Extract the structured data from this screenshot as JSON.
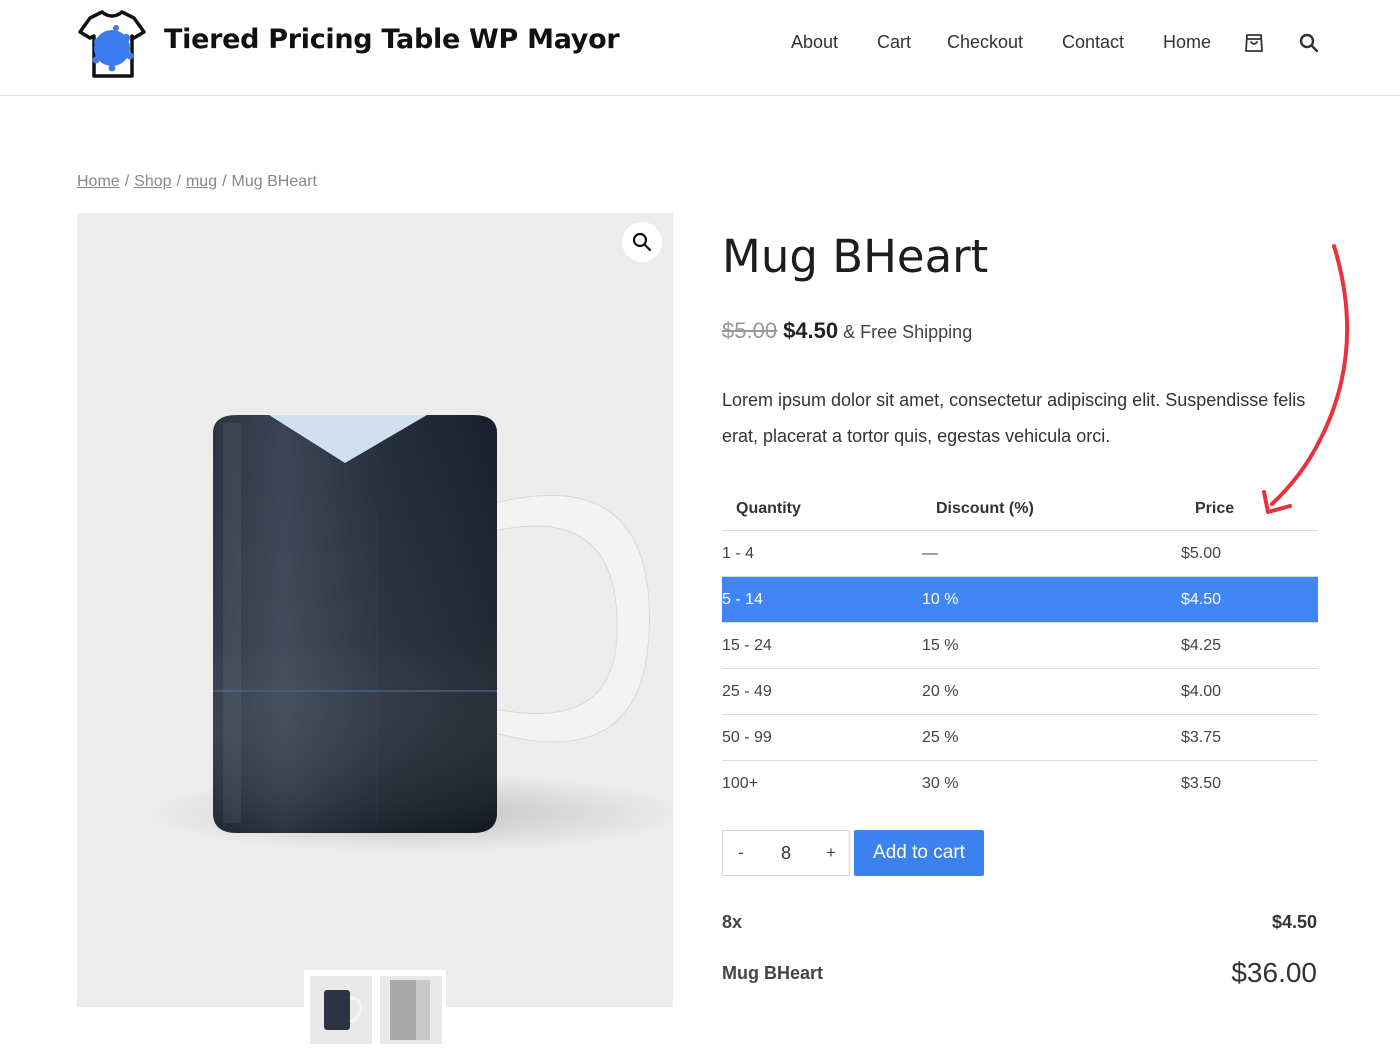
{
  "header": {
    "site_title": "Tiered Pricing Table WP Mayor",
    "nav": [
      "About",
      "Cart",
      "Checkout",
      "Contact",
      "Home"
    ],
    "icons": [
      "cart-icon",
      "search-icon"
    ]
  },
  "breadcrumb": {
    "items": [
      "Home",
      "Shop",
      "mug"
    ],
    "current": "Mug BHeart",
    "separator": "/"
  },
  "product": {
    "title": "Mug BHeart",
    "price_regular": "$5.00",
    "price_sale": "$4.50",
    "price_suffix": "& Free Shipping",
    "description": "Lorem ipsum dolor sit amet, consectetur adipiscing elit. Suspendisse felis erat, placerat a tortor quis, egestas vehicula orci."
  },
  "pricing_table": {
    "headers": [
      "Quantity",
      "Discount (%)",
      "Price"
    ],
    "rows": [
      {
        "quantity": "1 - 4",
        "discount": "—",
        "price": "$5.00"
      },
      {
        "quantity": "5 - 14",
        "discount": "10 %",
        "price": "$4.50"
      },
      {
        "quantity": "15 - 24",
        "discount": "15 %",
        "price": "$4.25"
      },
      {
        "quantity": "25 - 49",
        "discount": "20 %",
        "price": "$4.00"
      },
      {
        "quantity": "50 - 99",
        "discount": "25 %",
        "price": "$3.75"
      },
      {
        "quantity": "100+",
        "discount": "30 %",
        "price": "$3.50"
      }
    ],
    "active_row": 1,
    "active_color": "#4285f4"
  },
  "cart": {
    "minus": "-",
    "quantity": "8",
    "plus": "+",
    "add_to_cart": "Add to cart",
    "button_color": "#3c82ef"
  },
  "summary": {
    "qty_label": "8x",
    "unit_price": "$4.50",
    "product_label": "Mug BHeart",
    "total": "$36.00"
  },
  "annotation": {
    "arrow_color": "#e8323c"
  }
}
